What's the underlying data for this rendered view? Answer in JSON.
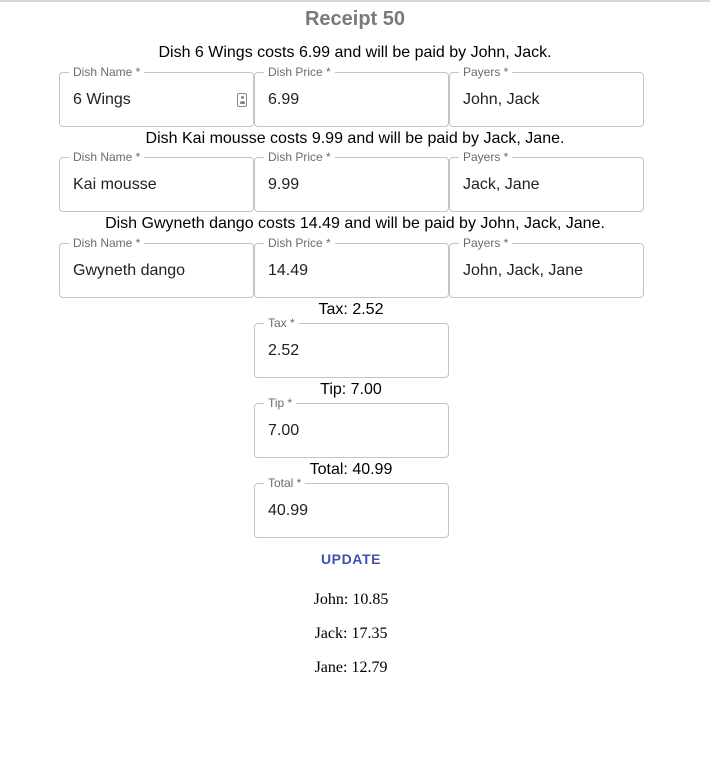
{
  "receipt": {
    "title": "Receipt 50"
  },
  "dishes": [
    {
      "sentence": "Dish 6 Wings costs 6.99 and will be paid by John, Jack.",
      "name_label": "Dish Name *",
      "name": "6 Wings",
      "price_label": "Dish Price *",
      "price": "6.99",
      "payers_label": "Payers *",
      "payers": "John, Jack"
    },
    {
      "sentence": "Dish Kai mousse costs 9.99 and will be paid by Jack, Jane.",
      "name_label": "Dish Name *",
      "name": "Kai mousse",
      "price_label": "Dish Price *",
      "price": "9.99",
      "payers_label": "Payers *",
      "payers": "Jack, Jane"
    },
    {
      "sentence": "Dish Gwyneth dango costs 14.49 and will be paid by John, Jack, Jane.",
      "name_label": "Dish Name *",
      "name": "Gwyneth dango",
      "price_label": "Dish Price *",
      "price": "14.49",
      "payers_label": "Payers *",
      "payers": "John, Jack, Jane"
    }
  ],
  "tax": {
    "caption": "Tax: 2.52",
    "label": "Tax *",
    "value": "2.52"
  },
  "tip": {
    "caption": "Tip: 7.00",
    "label": "Tip *",
    "value": "7.00"
  },
  "total": {
    "caption": "Total: 40.99",
    "label": "Total *",
    "value": "40.99"
  },
  "actions": {
    "update_label": "UPDATE"
  },
  "split": [
    "John: 10.85",
    "Jack: 17.35",
    "Jane: 12.79"
  ],
  "colors": {
    "accent": "#3f51b5",
    "title": "#7a7a7a",
    "field_border": "#c4c4c4"
  }
}
